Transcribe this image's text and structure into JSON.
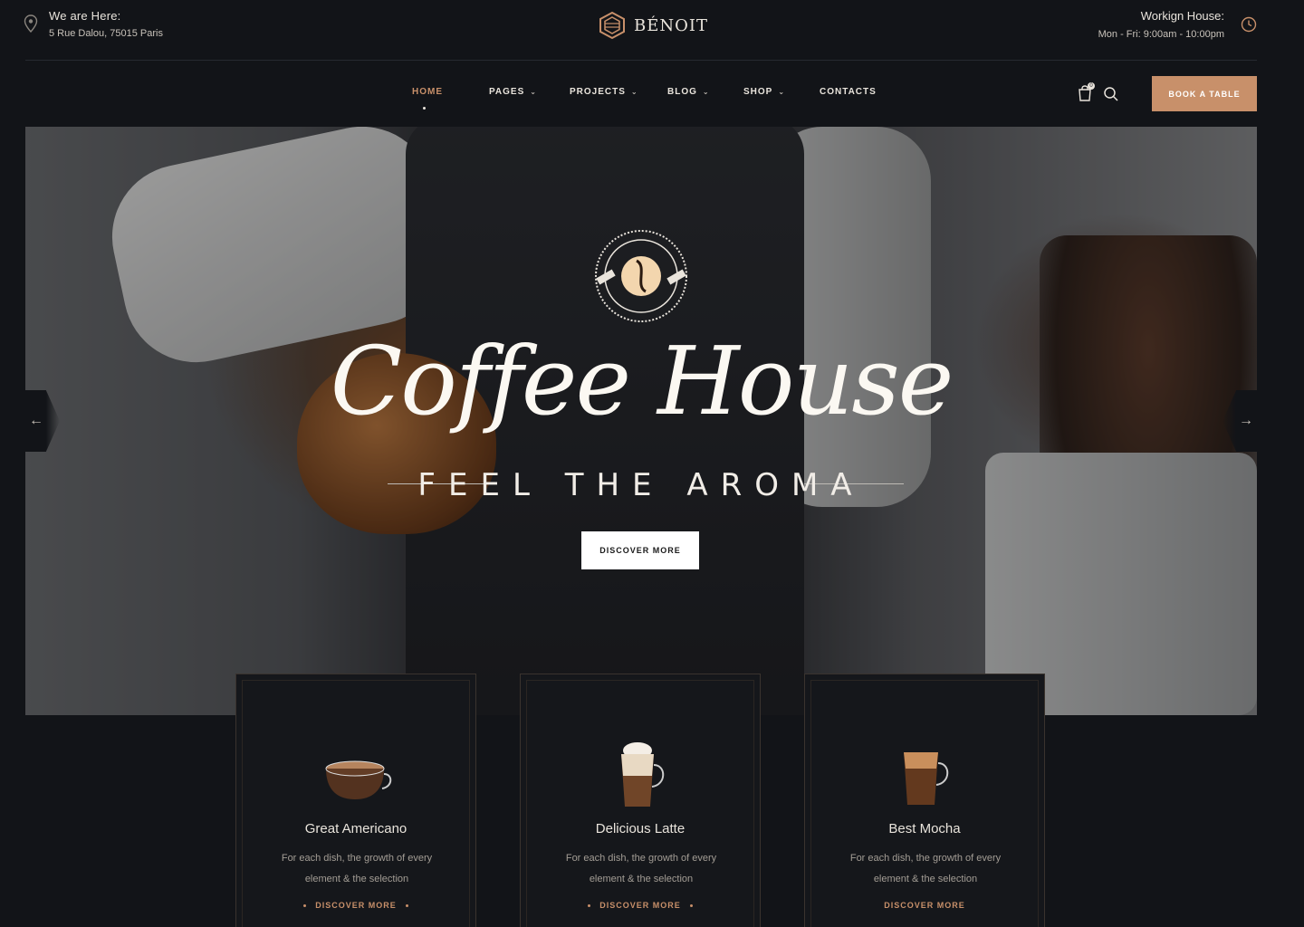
{
  "header": {
    "location_label": "We are Here:",
    "location_address": "5 Rue Dalou, 75015 Paris",
    "brand": "BÉNOIT",
    "hours_label": "Workign House:",
    "hours_value": "Mon - Fri: 9:00am - 10:00pm"
  },
  "nav": {
    "items": [
      {
        "label": "HOME"
      },
      {
        "label": "PAGES"
      },
      {
        "label": "PROJECTS"
      },
      {
        "label": "BLOG"
      },
      {
        "label": "SHOP"
      },
      {
        "label": "CONTACTS"
      }
    ],
    "cart_count": "0",
    "book_label": "BOOK A TABLE"
  },
  "hero": {
    "title": "Coffee House",
    "subtitle": "FEEL THE AROMA",
    "cta": "DISCOVER MORE"
  },
  "cards": [
    {
      "name": "Great Americano",
      "desc": "For each dish, the growth of every element & the selection",
      "cta": "DISCOVER MORE"
    },
    {
      "name": "Delicious Latte",
      "desc": "For each dish, the growth of every element & the selection",
      "cta": "DISCOVER MORE"
    },
    {
      "name": "Best Mocha",
      "desc": "For each dish, the growth of every element & the selection",
      "cta": "DISCOVER MORE"
    }
  ],
  "colors": {
    "background": "#121418",
    "accent": "#c8906a",
    "text": "#e9e4dc"
  },
  "icons": [
    "map-pin-icon",
    "logo-mark-icon",
    "clock-icon",
    "cart-icon",
    "search-icon",
    "arrow-left-icon",
    "arrow-right-icon",
    "coffee-cup-icon"
  ]
}
